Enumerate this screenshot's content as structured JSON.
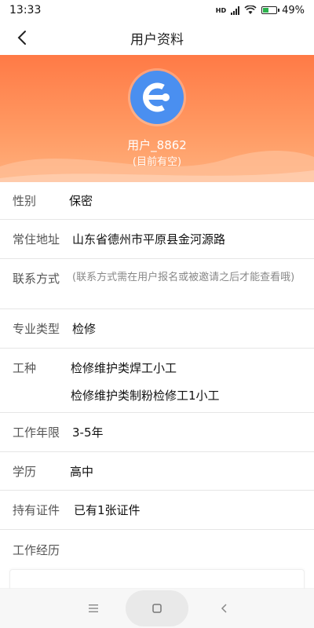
{
  "status_bar": {
    "time": "13:33",
    "network": "HD",
    "battery": "49%",
    "battery_level": 0.49
  },
  "header": {
    "title": "用户资料"
  },
  "profile": {
    "name": "用户_8862",
    "status": "(目前有空)"
  },
  "fields": {
    "gender": {
      "label": "性别",
      "value": "保密"
    },
    "address": {
      "label": "常住地址",
      "value": "山东省德州市平原县金河源路"
    },
    "contact": {
      "label": "联系方式",
      "value": "(联系方式需在用户报名或被邀请之后才能查看哦)"
    },
    "specialty": {
      "label": "专业类型",
      "value": "检修"
    },
    "job_type": {
      "label": "工种",
      "values": [
        "检修维护类焊工小工",
        "检修维护类制粉检修工1小工"
      ]
    },
    "years": {
      "label": "工作年限",
      "value": "3-5年"
    },
    "education": {
      "label": "学历",
      "value": "高中"
    },
    "certificates": {
      "label": "持有证件",
      "value": "已有1张证件"
    },
    "experience": {
      "label": "工作经历"
    }
  },
  "colors": {
    "accent": "#ff7a46",
    "avatar": "#4a8ff0"
  }
}
